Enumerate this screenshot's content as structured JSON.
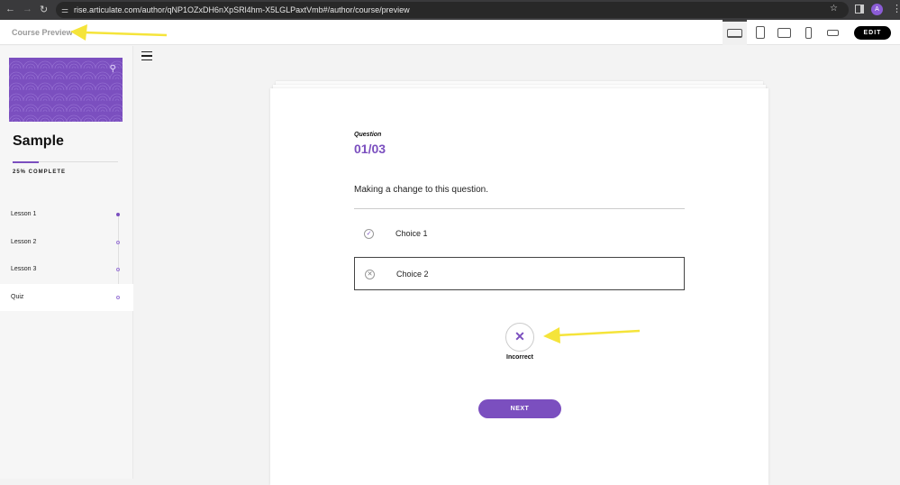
{
  "browser": {
    "url": "rise.articulate.com/author/qNP1OZxDH6nXpSRl4hm-X5LGLPaxtVmb#/author/course/preview",
    "avatar_letter": "A"
  },
  "appbar": {
    "title": "Course Preview",
    "edit_label": "EDIT",
    "devices": [
      "desktop",
      "tablet-portrait",
      "tablet-landscape",
      "phone-portrait",
      "phone-landscape"
    ]
  },
  "sidebar": {
    "course_title": "Sample",
    "progress_percent": 25,
    "progress_label": "25% COMPLETE",
    "lessons": [
      {
        "label": "Lesson 1",
        "complete": true
      },
      {
        "label": "Lesson 2",
        "complete": false
      },
      {
        "label": "Lesson 3",
        "complete": false
      },
      {
        "label": "Quiz",
        "complete": false,
        "current": true
      }
    ]
  },
  "quiz": {
    "question_label": "Question",
    "question_number": "01/03",
    "question_text": "Making a change to this question.",
    "choices": [
      {
        "label": "Choice 1",
        "icon": "check-circle-icon"
      },
      {
        "label": "Choice 2",
        "icon": "x-circle-icon",
        "selected": true
      }
    ],
    "result_label": "Incorrect",
    "next_label": "NEXT"
  },
  "colors": {
    "accent": "#7b4fbf",
    "annotation": "#f5e43a"
  }
}
